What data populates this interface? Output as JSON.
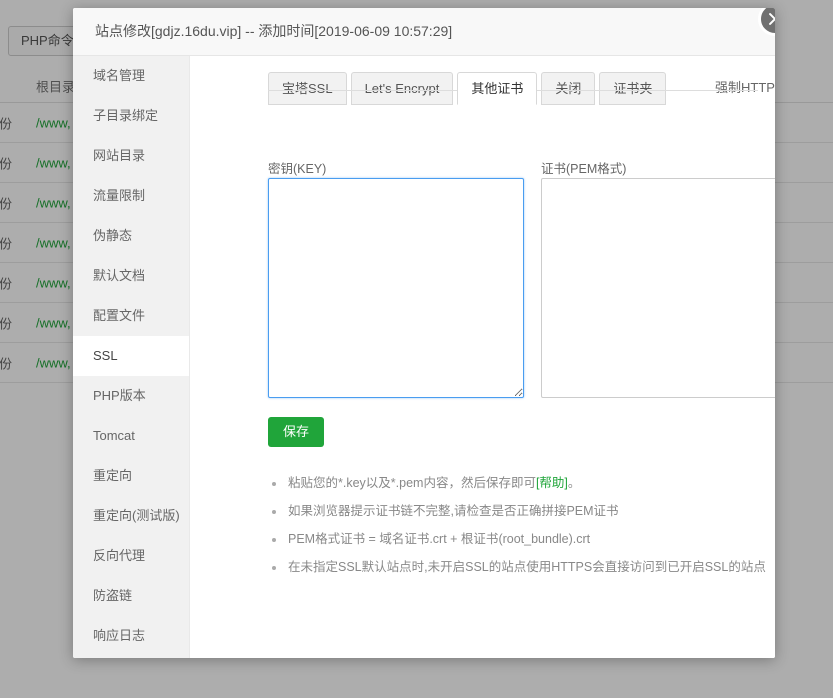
{
  "background": {
    "php_cli_button": "PHP命令行",
    "table": {
      "headers": [
        "份",
        "根目录"
      ],
      "rows": [
        [
          "备份",
          "/www,"
        ],
        [
          "备份",
          "/www,"
        ],
        [
          "备份",
          "/www,"
        ],
        [
          "备份",
          "/www,"
        ],
        [
          "备份",
          "/www,"
        ],
        [
          "备份",
          "/www,"
        ],
        [
          "备份",
          "/www,"
        ]
      ]
    }
  },
  "modal": {
    "title": "站点修改[gdjz.16du.vip] -- 添加时间[2019-06-09 10:57:29]",
    "close_icon": "close-icon",
    "sidebar": {
      "items": [
        {
          "label": "域名管理",
          "active": false
        },
        {
          "label": "子目录绑定",
          "active": false
        },
        {
          "label": "网站目录",
          "active": false
        },
        {
          "label": "流量限制",
          "active": false
        },
        {
          "label": "伪静态",
          "active": false
        },
        {
          "label": "默认文档",
          "active": false
        },
        {
          "label": "配置文件",
          "active": false
        },
        {
          "label": "SSL",
          "active": true
        },
        {
          "label": "PHP版本",
          "active": false
        },
        {
          "label": "Tomcat",
          "active": false
        },
        {
          "label": "重定向",
          "active": false
        },
        {
          "label": "重定向(测试版)",
          "active": false
        },
        {
          "label": "反向代理",
          "active": false
        },
        {
          "label": "防盗链",
          "active": false
        },
        {
          "label": "响应日志",
          "active": false
        }
      ]
    },
    "tabs": [
      {
        "label": "宝塔SSL",
        "active": false
      },
      {
        "label": "Let's Encrypt",
        "active": false
      },
      {
        "label": "其他证书",
        "active": true
      },
      {
        "label": "关闭",
        "active": false
      },
      {
        "label": "证书夹",
        "active": false
      }
    ],
    "force_https": {
      "label": "强制HTTPS",
      "enabled": false
    },
    "key_field": {
      "label": "密钥(KEY)",
      "value": "",
      "placeholder": ""
    },
    "pem_field": {
      "label": "证书(PEM格式)",
      "value": "",
      "placeholder": ""
    },
    "save_button": "保存",
    "notes": [
      {
        "before": "粘贴您的*.key以及*.pem内容，然后保存即可",
        "link": "[帮助]",
        "after": "。"
      },
      {
        "before": "如果浏览器提示证书链不完整,请检查是否正确拼接PEM证书",
        "link": "",
        "after": ""
      },
      {
        "before": "PEM格式证书 = 域名证书.crt + 根证书(root_bundle).crt",
        "link": "",
        "after": ""
      },
      {
        "before": "在未指定SSL默认站点时,未开启SSL的站点使用HTTPS会直接访问到已开启SSL的站点",
        "link": "",
        "after": ""
      }
    ]
  },
  "colors": {
    "accent_green": "#20a53a",
    "focus_blue": "#4a9df0"
  }
}
